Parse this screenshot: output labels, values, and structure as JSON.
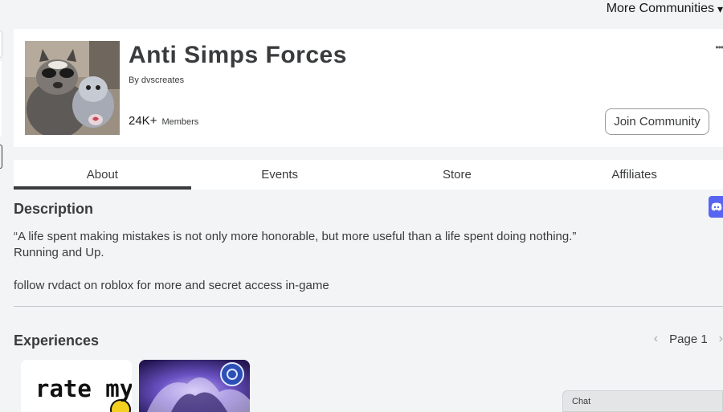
{
  "top_nav": {
    "more_communities": "More Communities"
  },
  "group": {
    "name": "Anti Simps Forces",
    "by_prefix": "By",
    "owner": "dvscreates",
    "member_count": "24K+",
    "members_label": "Members",
    "join_label": "Join Community"
  },
  "tabs": [
    {
      "label": "About",
      "active": true
    },
    {
      "label": "Events",
      "active": false
    },
    {
      "label": "Store",
      "active": false
    },
    {
      "label": "Affiliates",
      "active": false
    }
  ],
  "description": {
    "title": "Description",
    "lines": [
      "“A life spent making mistakes is not only more honorable, but more useful than a life spent doing nothing.”",
      "Running and Up.",
      "follow rvdact on roblox for more and secret access in-game"
    ]
  },
  "experiences": {
    "title": "Experiences",
    "page_label": "Page 1",
    "tiles": [
      {
        "text": "rate my avatar?"
      },
      {
        "text": ""
      }
    ]
  },
  "chat": {
    "label": "Chat"
  },
  "colors": {
    "accent": "#393b3d",
    "discord": "#5865f2",
    "background": "#f2f4f5"
  },
  "icons": [
    "chevron-down-icon",
    "more-dots-icon",
    "discord-icon",
    "chevron-left-icon",
    "chevron-right-icon"
  ]
}
